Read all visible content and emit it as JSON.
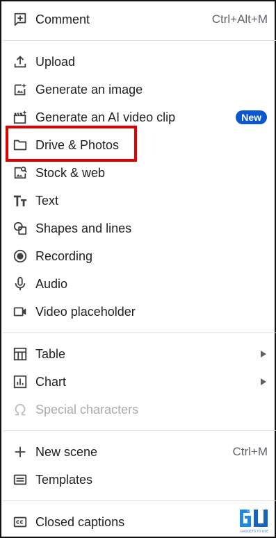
{
  "menu": {
    "comment": {
      "label": "Comment",
      "shortcut": "Ctrl+Alt+M",
      "icon": "add-comment-icon"
    },
    "upload": {
      "label": "Upload",
      "icon": "upload-icon"
    },
    "generate_image": {
      "label": "Generate an image",
      "icon": "image-sparkle-icon"
    },
    "generate_video": {
      "label": "Generate an AI video clip",
      "badge": "New",
      "icon": "clapper-sparkle-icon"
    },
    "drive_photos": {
      "label": "Drive & Photos",
      "icon": "folder-icon"
    },
    "stock_web": {
      "label": "Stock & web",
      "icon": "image-search-icon"
    },
    "text": {
      "label": "Text",
      "icon": "text-size-icon"
    },
    "shapes": {
      "label": "Shapes and lines",
      "icon": "shapes-icon"
    },
    "recording": {
      "label": "Recording",
      "icon": "record-icon"
    },
    "audio": {
      "label": "Audio",
      "icon": "microphone-icon"
    },
    "video_placeholder": {
      "label": "Video placeholder",
      "icon": "videocam-icon"
    },
    "table": {
      "label": "Table",
      "icon": "table-icon"
    },
    "chart": {
      "label": "Chart",
      "icon": "chart-icon"
    },
    "special_chars": {
      "label": "Special characters",
      "icon": "omega-icon"
    },
    "new_scene": {
      "label": "New scene",
      "shortcut": "Ctrl+M",
      "icon": "plus-icon"
    },
    "templates": {
      "label": "Templates",
      "icon": "templates-icon"
    },
    "closed_captions": {
      "label": "Closed captions",
      "icon": "closed-captions-icon"
    }
  },
  "colors": {
    "highlight": "#e00000",
    "badge": "#0b57d0",
    "text": "#202124",
    "disabled": "#a8abb0"
  },
  "watermark": {
    "text": "GADGETS TO USE"
  }
}
